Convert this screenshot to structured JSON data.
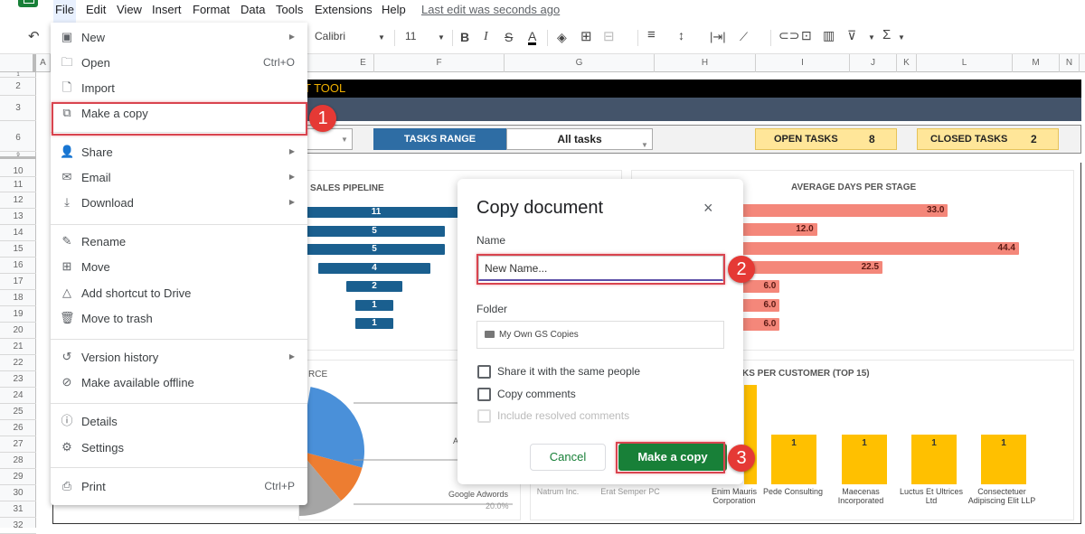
{
  "menubar": {
    "items": [
      "File",
      "Edit",
      "View",
      "Insert",
      "Format",
      "Data",
      "Tools",
      "Extensions",
      "Help"
    ],
    "last_edit": "Last edit was seconds ago"
  },
  "toolbar": {
    "font": "Calibri",
    "font_size": "11",
    "bold": "B",
    "italic": "I",
    "strike": "S",
    "text_color": "A",
    "sum": "Σ"
  },
  "columns": [
    "A",
    "E",
    "F",
    "G",
    "H",
    "I",
    "J",
    "K",
    "L",
    "M",
    "N"
  ],
  "rows": [
    "1",
    "2",
    "3",
    "6",
    "9",
    "10",
    "11",
    "12",
    "13",
    "14",
    "15",
    "16",
    "17",
    "18",
    "19",
    "20",
    "21",
    "22",
    "23",
    "24",
    "25",
    "26",
    "27",
    "28",
    "29",
    "30",
    "31",
    "32"
  ],
  "sheet": {
    "title_fragment": "T TOOL",
    "tasks_range_label": "TASKS RANGE",
    "tasks_range_value": "All tasks",
    "open_tasks_label": "OPEN TASKS",
    "open_tasks_value": "8",
    "closed_tasks_label": "CLOSED TASKS",
    "closed_tasks_value": "2",
    "colors": {
      "title_bar": "#000000",
      "title_text": "#f0b000",
      "sub_bar": "#44546a",
      "range_label": "#2e6da4",
      "kpi": "#ffe699"
    }
  },
  "chart_data": [
    {
      "type": "bar",
      "orientation": "horizontal-funnel",
      "title": "SALES PIPELINE",
      "values": [
        11,
        5,
        5,
        4,
        2,
        1,
        1
      ],
      "color": "#1a5f8f"
    },
    {
      "type": "bar",
      "orientation": "horizontal",
      "title": "AVERAGE DAYS PER STAGE",
      "values": [
        33.0,
        12.0,
        44.4,
        22.5,
        6.0,
        6.0,
        6.0
      ],
      "labels": [
        "33.0",
        "12.0",
        "44.4",
        "22.5",
        "6.0",
        "6.0",
        "6.0"
      ],
      "color": "#f4877a"
    },
    {
      "type": "pie",
      "title": "RCE",
      "slices": [
        {
          "color": "#4a90d9",
          "label": "",
          "value": null
        },
        {
          "color": "#ed7d31",
          "label": "A",
          "value": null
        },
        {
          "color": "#a5a5a5",
          "label": "Google Adwords",
          "value": 20.0
        },
        {
          "color": "#ffc000",
          "label": "",
          "value": 20.0
        }
      ],
      "visible_labels": [
        "Google Adwords",
        "20.0%",
        "20.0%"
      ]
    },
    {
      "type": "bar",
      "orientation": "vertical",
      "title": "TASKS PER CUSTOMER (TOP 15)",
      "title_visible": "KS PER CUSTOMER (TOP 15)",
      "categories": [
        "Natrum Inc.",
        "Erat Semper PC",
        "Enim Mauris Corporation",
        "Pede Consulting",
        "Maecenas Incorporated",
        "Luctus Et Ultrices Ltd",
        "Consectetuer Adipiscing Elit LLP"
      ],
      "values": [
        null,
        null,
        2,
        1,
        1,
        1,
        1
      ],
      "value_labels": [
        "",
        "",
        "",
        "1",
        "1",
        "1",
        "1"
      ],
      "color": "#ffc000"
    }
  ],
  "file_menu": {
    "items": [
      {
        "label": "New",
        "icon": "new-icon",
        "submenu": true
      },
      {
        "label": "Open",
        "icon": "folder-icon",
        "shortcut": "Ctrl+O"
      },
      {
        "label": "Import",
        "icon": "file-icon"
      },
      {
        "label": "Make a copy",
        "icon": "copy-icon"
      },
      {
        "label": "Share",
        "icon": "share-icon",
        "submenu": true
      },
      {
        "label": "Email",
        "icon": "email-icon",
        "submenu": true
      },
      {
        "label": "Download",
        "icon": "download-icon",
        "submenu": true
      },
      {
        "label": "Rename",
        "icon": "rename-icon"
      },
      {
        "label": "Move",
        "icon": "move-icon"
      },
      {
        "label": "Add shortcut to Drive",
        "icon": "drive-shortcut-icon"
      },
      {
        "label": "Move to trash",
        "icon": "trash-icon"
      },
      {
        "label": "Version history",
        "icon": "history-icon",
        "submenu": true
      },
      {
        "label": "Make available offline",
        "icon": "offline-icon"
      },
      {
        "label": "Details",
        "icon": "info-icon"
      },
      {
        "label": "Settings",
        "icon": "gear-icon"
      },
      {
        "label": "Print",
        "icon": "print-icon",
        "shortcut": "Ctrl+P"
      }
    ]
  },
  "dialog": {
    "title": "Copy document",
    "close": "×",
    "name_label": "Name",
    "name_value": "New Name...",
    "folder_label": "Folder",
    "folder_value": "My Own GS Copies",
    "share_label": "Share it with the same people",
    "copy_comments_label": "Copy comments",
    "include_resolved_label": "Include resolved comments",
    "cancel_label": "Cancel",
    "confirm_label": "Make a copy"
  },
  "steps": [
    "1",
    "2",
    "3"
  ],
  "colors": {
    "accent_green": "#188038",
    "step_red": "#e53935",
    "highlight": "#d9444f"
  }
}
